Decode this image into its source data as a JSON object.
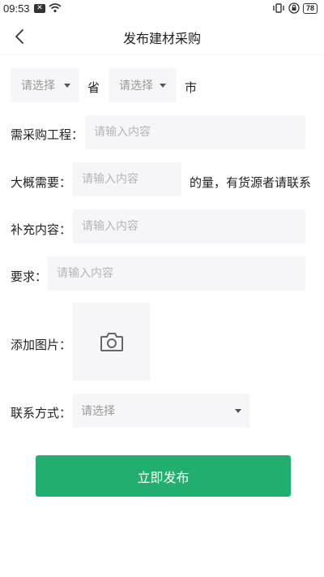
{
  "status_bar": {
    "time": "09:53",
    "notification_icon": "x-box-icon",
    "battery_level": "78"
  },
  "nav": {
    "title": "发布建材采购",
    "back_icon": "chevron-left-icon"
  },
  "region": {
    "province_select": "请选择",
    "province_label": "省",
    "city_select": "请选择",
    "city_label": "市"
  },
  "form": {
    "project_label": "需采购工程：",
    "project_placeholder": "请输入内容",
    "need_label": "大概需要：",
    "need_placeholder": "请输入内容",
    "need_suffix": "的量，有货源者请联系",
    "supplement_label": "补充内容：",
    "supplement_placeholder": "请输入内容",
    "requirement_label": "要求：",
    "requirement_placeholder": "请输入内容",
    "image_label": "添加图片：",
    "contact_label": "联系方式：",
    "contact_select": "请选择"
  },
  "submit_label": "立即发布",
  "colors": {
    "primary": "#22ae6e",
    "field_bg": "#f6f6f8",
    "placeholder": "#b5b5b8"
  }
}
